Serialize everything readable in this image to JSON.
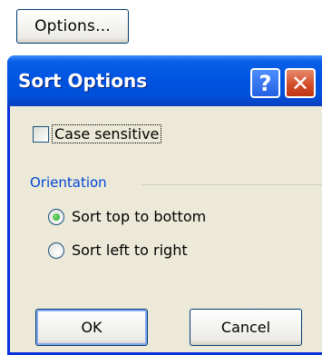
{
  "options_button": {
    "label": "Options..."
  },
  "dialog": {
    "title": "Sort Options",
    "help_glyph": "?",
    "close_glyph": "✕"
  },
  "case_sensitive": {
    "label": "Case sensitive",
    "checked": false
  },
  "orientation": {
    "group_label": "Orientation",
    "options": [
      {
        "label": "Sort top to bottom",
        "selected": true
      },
      {
        "label": "Sort left to right",
        "selected": false
      }
    ]
  },
  "buttons": {
    "ok": "OK",
    "cancel": "Cancel"
  },
  "colors": {
    "titlebar": "#0054e3",
    "dialog_bg": "#ece9d8",
    "group_label": "#0046d5",
    "close": "#d14a26"
  }
}
